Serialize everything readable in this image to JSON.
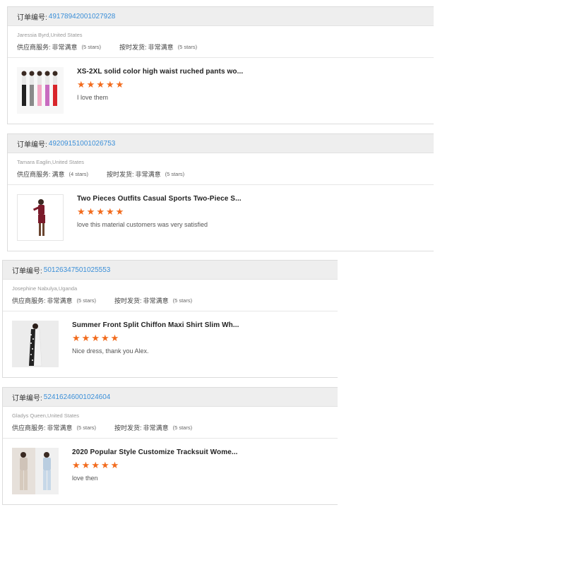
{
  "order_label": "订单编号:",
  "colors": {
    "accent": "#3b8fd8",
    "star": "#f26b1d",
    "header_bg": "#eeeeee"
  },
  "icons": {
    "star": "star-icon"
  },
  "reviews": [
    {
      "order_no": "49178942001027928",
      "buyer": "Jaressia Byrd,United States",
      "service_label": "供应商服务:",
      "service_value": "非常满意",
      "service_stars": "(5 stars)",
      "shipping_label": "按时发货:",
      "shipping_value": "非常满意",
      "shipping_stars": "(5 stars)",
      "product_title": "XS-2XL solid color high waist ruched pants wo...",
      "rating": 5,
      "comment": "I love them"
    },
    {
      "order_no": "49209151001026753",
      "buyer": "Tamara Eaglin,United States",
      "service_label": "供应商服务:",
      "service_value": "满意",
      "service_stars": "(4 stars)",
      "shipping_label": "按时发货:",
      "shipping_value": "非常满意",
      "shipping_stars": "(5 stars)",
      "product_title": "Two Pieces Outfits Casual Sports Two-Piece S...",
      "rating": 5,
      "comment": "love this material customers was very satisfied"
    },
    {
      "order_no": "50126347501025553",
      "buyer": "Josephine Nabulya,Uganda",
      "service_label": "供应商服务:",
      "service_value": "非常满意",
      "service_stars": "(5 stars)",
      "shipping_label": "按时发货:",
      "shipping_value": "非常满意",
      "shipping_stars": "(5 stars)",
      "product_title": "Summer Front Split Chiffon Maxi Shirt Slim Wh...",
      "rating": 5,
      "comment": "Nice dress, thank you Alex."
    },
    {
      "order_no": "52416246001024604",
      "buyer": "Gladys Queen,United States",
      "service_label": "供应商服务:",
      "service_value": "非常满意",
      "service_stars": "(5 stars)",
      "shipping_label": "按时发货:",
      "shipping_value": "非常满意",
      "shipping_stars": "(5 stars)",
      "product_title": "2020 Popular Style Customize Tracksuit Wome...",
      "rating": 5,
      "comment": "love then"
    }
  ]
}
